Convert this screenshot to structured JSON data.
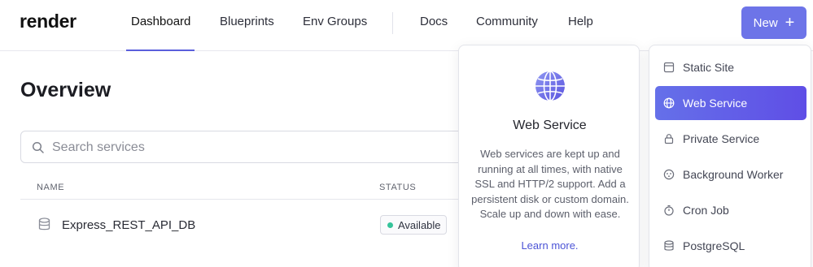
{
  "brand": {
    "logo_text": "render"
  },
  "nav": {
    "items": [
      {
        "label": "Dashboard"
      },
      {
        "label": "Blueprints"
      },
      {
        "label": "Env Groups"
      },
      {
        "label": "Docs"
      },
      {
        "label": "Community"
      },
      {
        "label": "Help"
      }
    ],
    "active": "Dashboard"
  },
  "new_button": {
    "label": "New",
    "icon": "plus-icon"
  },
  "overview": {
    "title": "Overview",
    "search": {
      "placeholder": "Search services",
      "value": ""
    },
    "table": {
      "columns": [
        "NAME",
        "STATUS"
      ],
      "rows": [
        {
          "icon": "database-icon",
          "name": "Express_REST_API_DB",
          "status": "Available"
        }
      ]
    }
  },
  "info_card": {
    "icon": "globe-icon",
    "title": "Web Service",
    "description": "Web services are kept up and running at all times, with native SSL and HTTP/2 support. Add a persistent disk or custom domain. Scale up and down with ease.",
    "link": "Learn more."
  },
  "new_menu": {
    "items": [
      {
        "label": "Static Site",
        "icon": "browser-window-icon"
      },
      {
        "label": "Web Service",
        "icon": "globe-icon"
      },
      {
        "label": "Private Service",
        "icon": "lock-icon"
      },
      {
        "label": "Background Worker",
        "icon": "cog-icon"
      },
      {
        "label": "Cron Job",
        "icon": "stopwatch-icon"
      },
      {
        "label": "PostgreSQL",
        "icon": "database-icon"
      }
    ],
    "selected": "Web Service"
  },
  "colors": {
    "accent": "#6d74e8",
    "active_gradient_start": "#6570e9",
    "active_gradient_end": "#5f4ee6",
    "status_available": "#35c39a",
    "link": "#4b53d6"
  }
}
